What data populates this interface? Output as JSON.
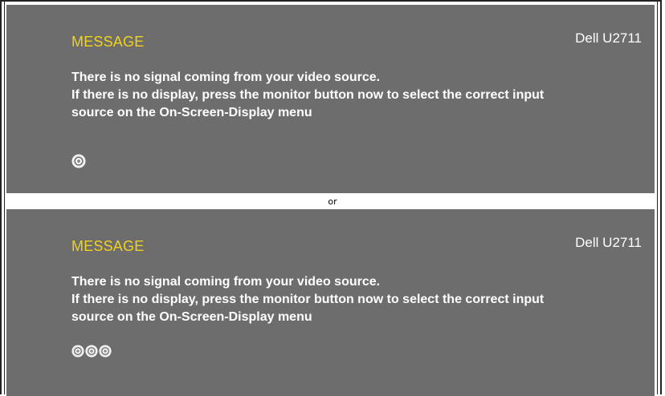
{
  "osd_panels": [
    {
      "title": "MESSAGE",
      "model": "Dell U2711",
      "lines": [
        "There is no signal coming from your video source.",
        "If there is no display, press the monitor button now to select the correct input",
        "source on the On-Screen-Display menu"
      ],
      "icons": [
        "input-source-icon"
      ]
    },
    {
      "title": "MESSAGE",
      "model": "Dell U2711",
      "lines": [
        "There is no signal coming from your video source.",
        "If there is no display, press the monitor button now to select the correct input",
        "source on the On-Screen-Display menu"
      ],
      "icons": [
        "input-source-icon",
        "input-source-icon",
        "input-source-icon"
      ]
    }
  ],
  "separator_label": "or",
  "colors": {
    "panel_background": "#6d6d6d",
    "title": "#f0d21e",
    "text": "#ffffff"
  }
}
